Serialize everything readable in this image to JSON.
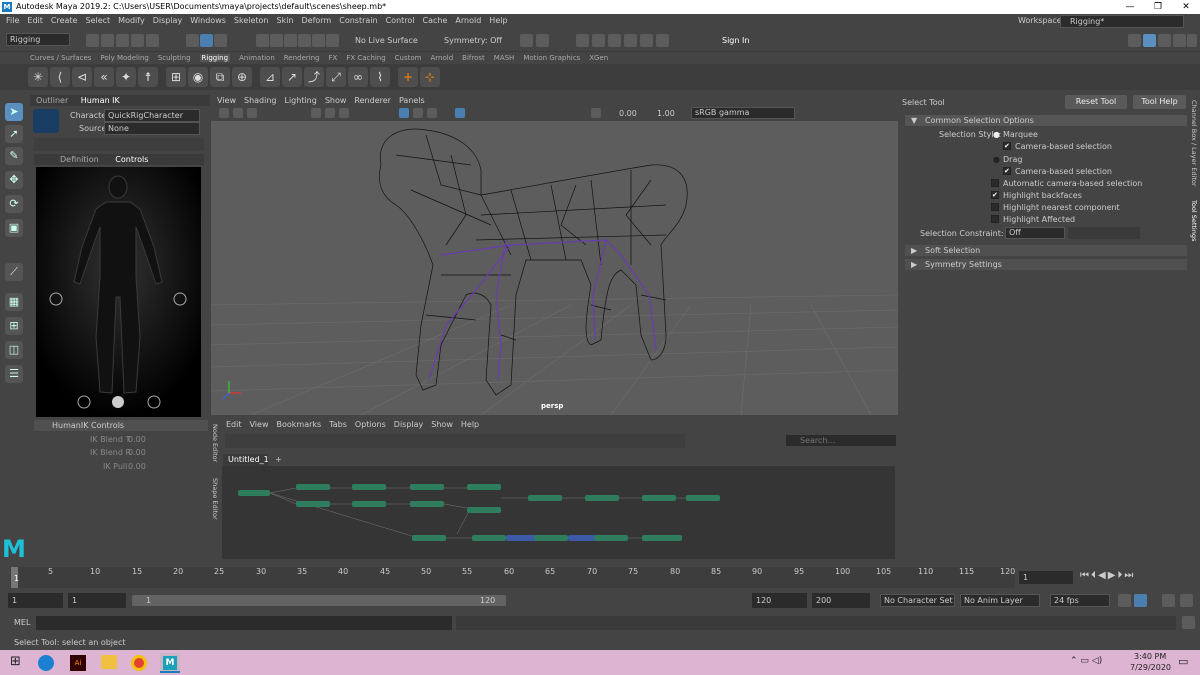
{
  "window": {
    "title": "Autodesk Maya 2019.2: C:\\Users\\USER\\Documents\\maya\\projects\\default\\scenes\\sheep.mb*",
    "logo": "M"
  },
  "menu": [
    "File",
    "Edit",
    "Create",
    "Select",
    "Modify",
    "Display",
    "Windows",
    "Skeleton",
    "Skin",
    "Deform",
    "Constrain",
    "Control",
    "Cache",
    "Arnold",
    "Help"
  ],
  "workspace": {
    "label": "Workspace :",
    "value": "Rigging*"
  },
  "status_line": {
    "menuset": "Rigging",
    "live_surface": "No Live Surface",
    "symmetry": "Symmetry: Off",
    "sign_in": "Sign In"
  },
  "shelf_tabs": [
    "Curves / Surfaces",
    "Poly Modeling",
    "Sculpting",
    "Rigging",
    "Animation",
    "Rendering",
    "FX",
    "FX Caching",
    "Custom",
    "Arnold",
    "Bifrost",
    "MASH",
    "Motion Graphics",
    "XGen"
  ],
  "shelf_active": "Rigging",
  "hik": {
    "tabs": [
      "Outliner",
      "Human IK"
    ],
    "character_label": "Character:",
    "character": "QuickRigCharacter",
    "source_label": "Source:",
    "source": "None",
    "subtabs": [
      "Definition",
      "Controls"
    ],
    "controls_header": "HumanIK Controls",
    "params": [
      {
        "label": "IK Blend T",
        "value": "0.00"
      },
      {
        "label": "IK Blend R",
        "value": "0.00"
      },
      {
        "label": "IK Pull",
        "value": "0.00"
      }
    ]
  },
  "viewport": {
    "menu": [
      "View",
      "Shading",
      "Lighting",
      "Show",
      "Renderer",
      "Panels"
    ],
    "camera": "persp",
    "near": "0.00",
    "far": "1.00",
    "color_space": "sRGB gamma"
  },
  "node_editor": {
    "menu": [
      "Edit",
      "View",
      "Bookmarks",
      "Tabs",
      "Options",
      "Display",
      "Show",
      "Help"
    ],
    "tab": "Untitled_1",
    "add_tab": "+",
    "search_placeholder": "Search...",
    "vertical_label": "Node Editor",
    "shape_label": "Shape Editor"
  },
  "tool_settings": {
    "title": "Select Tool",
    "reset": "Reset Tool",
    "help": "Tool Help",
    "section": "Common Selection Options",
    "style_label": "Selection Style:",
    "options": [
      {
        "label": "Marquee",
        "type": "radio",
        "checked": true
      },
      {
        "label": "Camera-based selection",
        "type": "check",
        "checked": true
      },
      {
        "label": "Drag",
        "type": "radio",
        "checked": false
      },
      {
        "label": "Camera-based selection",
        "type": "check",
        "checked": true
      },
      {
        "label": "Automatic camera-based selection",
        "type": "check",
        "checked": false
      },
      {
        "label": "Highlight backfaces",
        "type": "check",
        "checked": true
      },
      {
        "label": "Highlight nearest component",
        "type": "check",
        "checked": false
      },
      {
        "label": "Highlight Affected",
        "type": "check",
        "checked": false
      }
    ],
    "constraint_label": "Selection Constraint:",
    "constraint": "Off",
    "soft": "Soft Selection",
    "symmetry": "Symmetry Settings",
    "side_tabs": [
      "Channel Box / Layer Editor",
      "Tool Settings"
    ]
  },
  "timeline": {
    "ticks": [
      "1",
      "5",
      "10",
      "15",
      "20",
      "25",
      "30",
      "35",
      "40",
      "45",
      "50",
      "55",
      "60",
      "65",
      "70",
      "75",
      "80",
      "85",
      "90",
      "95",
      "100",
      "105",
      "110",
      "115",
      "120"
    ],
    "current": "1",
    "range": {
      "start": "1",
      "start2": "1",
      "inner_start": "1",
      "inner_end": "120",
      "end": "120",
      "end2": "200"
    },
    "character_set": "No Character Set",
    "anim_layer": "No Anim Layer",
    "fps": "24 fps"
  },
  "command": {
    "lang": "MEL",
    "status": "Select Tool: select an object"
  },
  "taskbar": {
    "time": "3:40 PM",
    "date": "7/29/2020"
  }
}
